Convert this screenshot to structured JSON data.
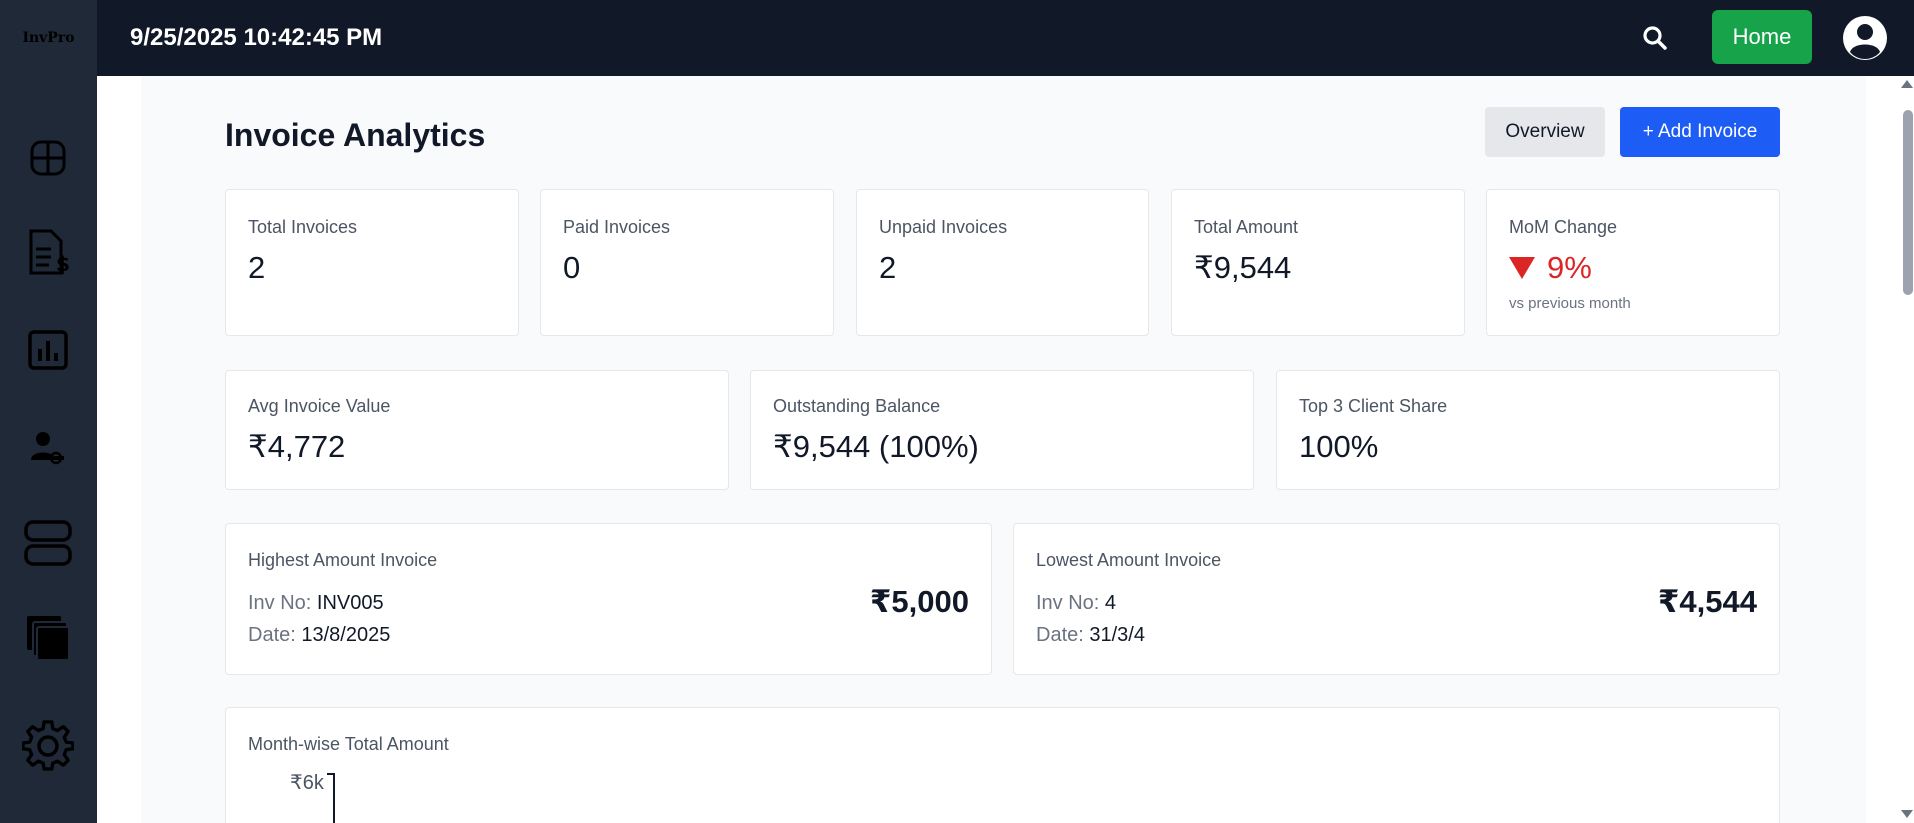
{
  "app": {
    "logo_text": "InvPro"
  },
  "topbar": {
    "datetime": "9/25/2025 10:42:45 PM",
    "home_label": "Home"
  },
  "sidebar": {
    "items": [
      {
        "icon": "dashboard-icon"
      },
      {
        "icon": "invoice-icon"
      },
      {
        "icon": "analytics-icon"
      },
      {
        "icon": "clients-icon"
      },
      {
        "icon": "layout-icon"
      },
      {
        "icon": "documents-icon"
      },
      {
        "icon": "gear-icon"
      }
    ]
  },
  "page": {
    "title": "Invoice Analytics",
    "overview_label": "Overview",
    "add_invoice_label": "+ Add Invoice"
  },
  "stats": {
    "total_invoices": {
      "label": "Total Invoices",
      "value": "2"
    },
    "paid_invoices": {
      "label": "Paid Invoices",
      "value": "0"
    },
    "unpaid_invoices": {
      "label": "Unpaid Invoices",
      "value": "2"
    },
    "total_amount": {
      "label": "Total Amount",
      "value": "₹9,544"
    },
    "mom_change": {
      "label": "MoM Change",
      "value": "9%",
      "sub": "vs previous month",
      "direction": "down",
      "color": "#dc2626"
    },
    "avg_invoice": {
      "label": "Avg Invoice Value",
      "value": "₹4,772"
    },
    "outstanding": {
      "label": "Outstanding Balance",
      "value": "₹9,544 (100%)"
    },
    "top3_share": {
      "label": "Top 3 Client Share",
      "value": "100%"
    }
  },
  "highest": {
    "label": "Highest Amount Invoice",
    "inv_label": "Inv No:",
    "inv_no": "INV005",
    "date_label": "Date:",
    "date": "13/8/2025",
    "amount": "₹5,000"
  },
  "lowest": {
    "label": "Lowest Amount Invoice",
    "inv_label": "Inv No:",
    "inv_no": "4",
    "date_label": "Date:",
    "date": "31/3/4",
    "amount": "₹4,544"
  },
  "month_chart": {
    "title": "Month-wise Total Amount",
    "y_tick": "₹6k"
  },
  "colors": {
    "sidebar_bg": "#1f2937",
    "topbar_bg": "#111827",
    "home_button": "#16a34a",
    "primary_button": "#1d5cf5",
    "negative": "#dc2626"
  }
}
